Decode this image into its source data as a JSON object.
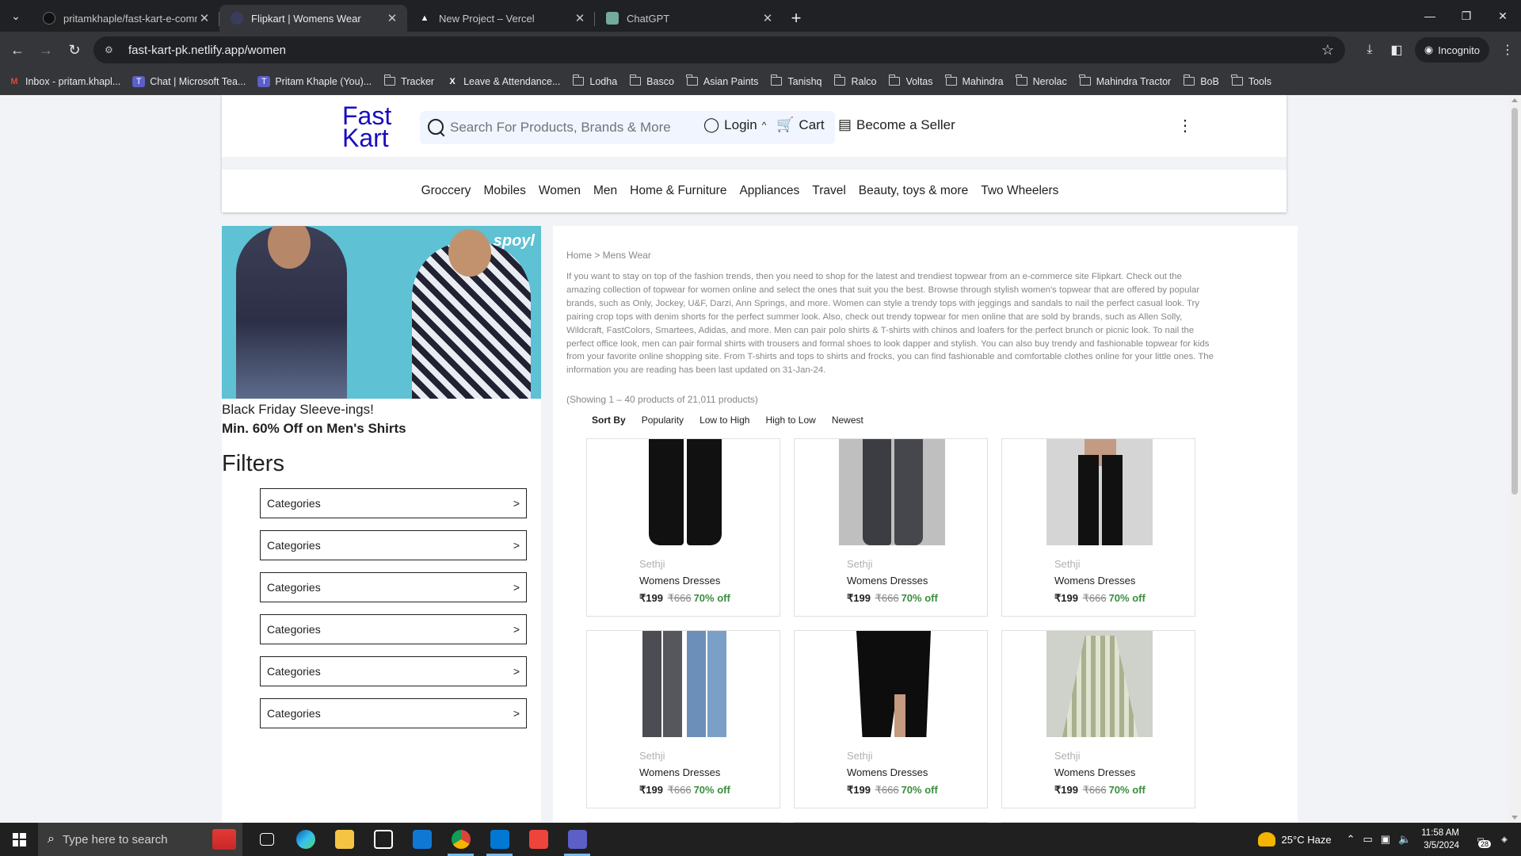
{
  "browser": {
    "tabs": [
      {
        "title": "pritamkhaple/fast-kart-e-comm",
        "active": false
      },
      {
        "title": "Flipkart | Womens Wear",
        "active": true
      },
      {
        "title": "New Project – Vercel",
        "active": false
      },
      {
        "title": "ChatGPT",
        "active": false
      }
    ],
    "url": "fast-kart-pk.netlify.app/women",
    "profile_label": "Incognito",
    "bookmarks": [
      {
        "label": "Inbox - pritam.khapl...",
        "icon": "gmail-icon"
      },
      {
        "label": "Chat | Microsoft Tea...",
        "icon": "teams-icon"
      },
      {
        "label": "Pritam Khaple (You)...",
        "icon": "teams-icon"
      },
      {
        "label": "Tracker",
        "icon": "folder-icon"
      },
      {
        "label": "Leave & Attendance...",
        "icon": "x-icon"
      },
      {
        "label": "Lodha",
        "icon": "folder-icon"
      },
      {
        "label": "Basco",
        "icon": "folder-icon"
      },
      {
        "label": "Asian Paints",
        "icon": "folder-icon"
      },
      {
        "label": "Tanishq",
        "icon": "folder-icon"
      },
      {
        "label": "Ralco",
        "icon": "folder-icon"
      },
      {
        "label": "Voltas",
        "icon": "folder-icon"
      },
      {
        "label": "Mahindra",
        "icon": "folder-icon"
      },
      {
        "label": "Nerolac",
        "icon": "folder-icon"
      },
      {
        "label": "Mahindra Tractor",
        "icon": "folder-icon"
      },
      {
        "label": "BoB",
        "icon": "folder-icon"
      },
      {
        "label": "Tools",
        "icon": "folder-icon"
      }
    ]
  },
  "header": {
    "logo_line1": "Fast",
    "logo_line2": "Kart",
    "search_placeholder": "Search For Products, Brands & More",
    "login_label": "Login",
    "login_caret": "^",
    "cart_label": "Cart",
    "seller_label": "Become a Seller",
    "categories": [
      "Groccery",
      "Mobiles",
      "Women",
      "Men",
      "Home & Furniture",
      "Appliances",
      "Travel",
      "Beauty, toys & more",
      "Two Wheelers"
    ]
  },
  "sidebar": {
    "banner_brand": "spoyl",
    "banner_title": "Black Friday Sleeve-ings!",
    "banner_offer": "Min. 60% Off on Men's Shirts",
    "filters_heading": "Filters",
    "filter_buttons": [
      {
        "label": "Categories",
        "arrow": ">"
      },
      {
        "label": "Categories",
        "arrow": ">"
      },
      {
        "label": "Categories",
        "arrow": ">"
      },
      {
        "label": "Categories",
        "arrow": ">"
      },
      {
        "label": "Categories",
        "arrow": ">"
      },
      {
        "label": "Categories",
        "arrow": ">"
      }
    ]
  },
  "main": {
    "breadcrumb": "Home > Mens Wear",
    "description": "If you want to stay on top of the fashion trends, then you need to shop for the latest and trendiest topwear from an e-commerce site Flipkart. Check out the amazing collection of topwear for women online and select the ones that suit you the best. Browse through stylish women's topwear that are offered by popular brands, such as Only, Jockey, U&F, Darzi, Ann Springs, and more. Women can style a trendy tops with jeggings and sandals to nail the perfect casual look. Try pairing crop tops with denim shorts for the perfect summer look. Also, check out trendy topwear for men online that are sold by brands, such as Allen Solly, Wildcraft, FastColors, Smartees, Adidas, and more. Men can pair polo shirts & T-shirts with chinos and loafers for the perfect brunch or picnic look. To nail the perfect office look, men can pair formal shirts with trousers and formal shoes to look dapper and stylish. You can also buy trendy and fashionable topwear for kids from your favorite online shopping site. From T-shirts and tops to shirts and frocks, you can find fashionable and comfortable clothes online for your little ones. The information you are reading has been last updated on 31-Jan-24.",
    "showing": "(Showing 1 – 40 products of 21,011 products)",
    "sort": {
      "label": "Sort By",
      "options": [
        "Popularity",
        "Low to High",
        "High to Low",
        "Newest"
      ]
    },
    "products": [
      {
        "brand": "Sethji",
        "name": "Womens Dresses",
        "price": "₹199",
        "mrp": "₹666",
        "discount": "70% off",
        "image": "black-trousers"
      },
      {
        "brand": "Sethji",
        "name": "Womens Dresses",
        "price": "₹199",
        "mrp": "₹666",
        "discount": "70% off",
        "image": "grey-jeans"
      },
      {
        "brand": "Sethji",
        "name": "Womens Dresses",
        "price": "₹199",
        "mrp": "₹666",
        "discount": "70% off",
        "image": "black-jeggings"
      },
      {
        "brand": "Sethji",
        "name": "Womens Dresses",
        "price": "₹199",
        "mrp": "₹666",
        "discount": "70% off",
        "image": "two-jeans"
      },
      {
        "brand": "Sethji",
        "name": "Womens Dresses",
        "price": "₹199",
        "mrp": "₹666",
        "discount": "70% off",
        "image": "black-skirt"
      },
      {
        "brand": "Sethji",
        "name": "Womens Dresses",
        "price": "₹199",
        "mrp": "₹666",
        "discount": "70% off",
        "image": "pleated-skirt"
      }
    ]
  },
  "taskbar": {
    "search_placeholder": "Type here to search",
    "weather": "25°C  Haze",
    "time": "11:58 AM",
    "date": "3/5/2024",
    "notifications": "28"
  }
}
